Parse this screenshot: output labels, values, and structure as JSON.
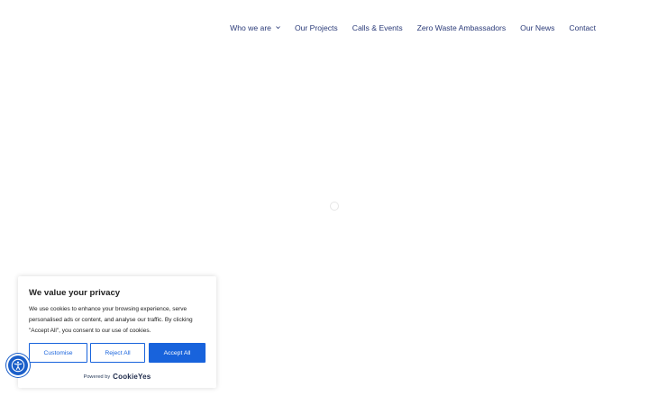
{
  "nav": {
    "items": [
      {
        "label": "Who we are",
        "has_dropdown": true
      },
      {
        "label": "Our Projects"
      },
      {
        "label": "Calls & Events"
      },
      {
        "label": "Zero Waste Ambassadors"
      },
      {
        "label": "Our News"
      },
      {
        "label": "Contact"
      }
    ]
  },
  "cookie": {
    "title": "We value your privacy",
    "text": "We use cookies to enhance your browsing experience, serve personalised ads or content, and analyse our traffic. By clicking \"Accept All\", you consent to our use of cookies.",
    "customise_label": "Customise",
    "reject_label": "Reject All",
    "accept_label": "Accept All",
    "powered_by": "Powered by",
    "brand": "CookieYes"
  },
  "accessibility": {
    "icon": "accessibility-icon"
  },
  "colors": {
    "nav_text": "#2a3a78",
    "accent": "#1863dc",
    "a11y_bg": "#1b5fc9"
  }
}
